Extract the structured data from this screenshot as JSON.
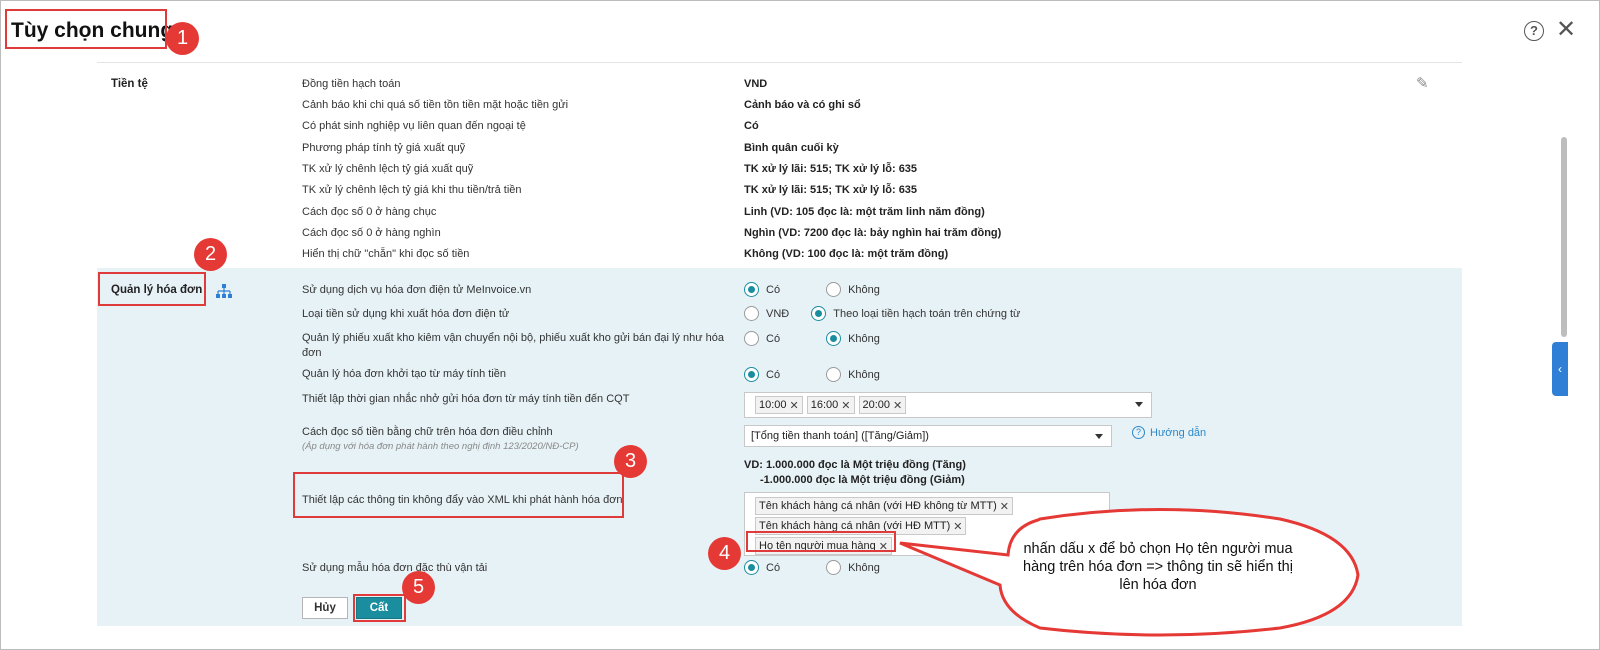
{
  "dialog": {
    "title": "Tùy chọn chung",
    "help_icon": "help-circle-icon",
    "close_icon": "close-icon"
  },
  "annotations": {
    "badges": [
      "1",
      "2",
      "3",
      "4",
      "5"
    ],
    "callout": "nhấn dấu x để bỏ chọn Họ tên người mua hàng trên hóa đơn => thông tin sẽ hiển thị lên hóa đơn"
  },
  "currency_section": {
    "title": "Tiền tệ",
    "edit_icon": "pencil-icon",
    "rows": [
      {
        "label": "Đồng tiền hạch toán",
        "value": "VND"
      },
      {
        "label": "Cảnh báo khi chi quá số tiền tồn tiền mặt hoặc tiền gửi",
        "value": "Cảnh báo và có ghi sổ"
      },
      {
        "label": "Có phát sinh nghiệp vụ liên quan đến ngoại tệ",
        "value": "Có"
      },
      {
        "label": "Phương pháp tính tỷ giá xuất quỹ",
        "value": "Bình quân cuối kỳ"
      },
      {
        "label": "TK xử lý chênh lệch tỷ giá xuất quỹ",
        "value": "TK xử lý lãi: 515; TK xử lý lỗ: 635"
      },
      {
        "label": "TK xử lý chênh lệch tỷ giá khi thu tiền/trả tiền",
        "value": "TK xử lý lãi: 515; TK xử lý lỗ: 635"
      },
      {
        "label": "Cách đọc số 0 ở hàng chục",
        "value": "Linh (VD: 105 đọc là: một trăm linh năm đồng)"
      },
      {
        "label": "Cách đọc số 0 ở hàng nghìn",
        "value": "Nghìn (VD: 7200 đọc là: bảy nghìn hai trăm đồng)"
      },
      {
        "label": "Hiển thị chữ \"chẵn\" khi đọc số tiền",
        "value": "Không (VD: 100 đọc là: một trăm đồng)"
      }
    ]
  },
  "invoice_section": {
    "title": "Quản lý hóa đơn",
    "icon": "structure-icon",
    "rows": {
      "einvoice": {
        "label": "Sử dụng dịch vụ hóa đơn điện tử MeInvoice.vn",
        "opt1": "Có",
        "opt2": "Không"
      },
      "currency": {
        "label": "Loại tiền sử dụng khi xuất hóa đơn điện tử",
        "opt1": "VNĐ",
        "opt2": "Theo loại tiền hạch toán trên chứng từ"
      },
      "warehouse": {
        "label": "Quản lý phiếu xuất kho kiêm vận chuyển nội bộ, phiếu xuất kho gửi bán đại lý như hóa đơn",
        "opt1": "Có",
        "opt2": "Không"
      },
      "cash_register": {
        "label": "Quản lý hóa đơn khởi tạo từ máy tính tiền",
        "opt1": "Có",
        "opt2": "Không"
      },
      "reminder": {
        "label": "Thiết lập thời gian nhắc nhở gửi hóa đơn từ máy tính tiền đến CQT",
        "tags": [
          "10:00",
          "16:00",
          "20:00"
        ]
      },
      "read_amount": {
        "label": "Cách đọc số tiền bằng chữ trên hóa đơn điều chỉnh",
        "note": "(Áp dụng với hóa đơn phát hành theo nghị định 123/2020/NĐ-CP)",
        "selected": "[Tổng tiền thanh toán] ([Tăng/Giảm])",
        "guide": "Hướng dẫn",
        "example_1": "VD: 1.000.000 đọc là Một triệu đồng (Tăng)",
        "example_2": "-1.000.000 đọc là Một triệu đồng (Giảm)"
      },
      "xml": {
        "label": "Thiết lập các thông tin không đẩy vào XML khi phát hành hóa đơn",
        "tags": [
          "Tên khách hàng cá nhân (với HĐ không từ MTT)",
          "Tên khách hàng cá nhân (với HĐ MTT)",
          "Họ tên người mua hàng"
        ]
      },
      "transport": {
        "label": "Sử dụng mẫu hóa đơn đặc thù vận tải",
        "opt1": "Có",
        "opt2": "Không"
      }
    },
    "cancel_label": "Hủy",
    "save_label": "Cất"
  },
  "colors": {
    "accent": "#1a8d9e",
    "annotation_red": "#e53935",
    "section_bg": "#e7f2f7",
    "link": "#2d88c8"
  }
}
